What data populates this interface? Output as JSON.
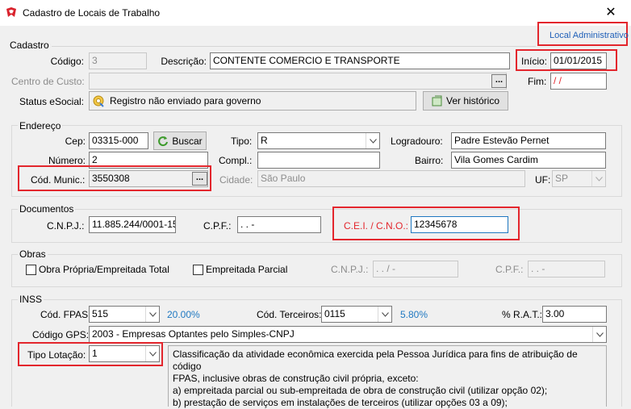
{
  "window": {
    "title": "Cadastro de Locais de Trabalho",
    "close_glyph": "✕"
  },
  "header": {
    "local_administrativo": "Local Administrativo"
  },
  "cadastro": {
    "section": "Cadastro",
    "codigo_label": "Código:",
    "codigo_value": "3",
    "descricao_label": "Descrição:",
    "descricao_value": "CONTENTE COMERCIO E TRANSPORTE",
    "inicio_label": "Início:",
    "inicio_value": "01/01/2015",
    "centro_label": "Centro de Custo:",
    "centro_value": "",
    "fim_label": "Fim:",
    "fim_value": " / /",
    "status_label": "Status eSocial:",
    "status_value": "Registro não enviado para governo",
    "historico_button": "Ver histórico",
    "ellipsis": "..."
  },
  "endereco": {
    "section": "Endereço",
    "cep_label": "Cep:",
    "cep_value": "03315-000",
    "buscar_button": "Buscar",
    "tipo_label": "Tipo:",
    "tipo_value": "R",
    "logradouro_label": "Logradouro:",
    "logradouro_value": "Padre Estevão Pernet",
    "numero_label": "Número:",
    "numero_value": "2",
    "compl_label": "Compl.:",
    "compl_value": "",
    "bairro_label": "Bairro:",
    "bairro_value": "Vila Gomes Cardim",
    "munic_label": "Cód. Munic.:",
    "munic_value": "3550308",
    "cidade_label": "Cidade:",
    "cidade_value": "São Paulo",
    "uf_label": "UF:",
    "uf_value": "SP",
    "ellipsis": "..."
  },
  "documentos": {
    "section": "Documentos",
    "cnpj_label": "C.N.P.J.:",
    "cnpj_value": "11.885.244/0001-15",
    "cpf_label": "C.P.F.:",
    "cpf_value": " .  .  -",
    "cei_label": "C.E.I. / C.N.O.:",
    "cei_value": "12345678"
  },
  "obras": {
    "section": "Obras",
    "propria_label": "Obra Própria/Empreitada Total",
    "parcial_label": "Empreitada Parcial",
    "cnpj_label": "C.N.P.J.:",
    "cnpj_value": " .  . /  -",
    "cpf_label": "C.P.F.:",
    "cpf_value": " .  .  -"
  },
  "inss": {
    "section": "INSS",
    "fpas_label": "Cód. FPAS:",
    "fpas_value": "515",
    "fpas_pct": "20.00%",
    "terceiros_label": "Cód. Terceiros:",
    "terceiros_value": "0115",
    "terceiros_pct": "5.80%",
    "rat_label": "% R.A.T.:",
    "rat_value": "3.00",
    "gps_label": "Código GPS:",
    "gps_value": "2003  - Empresas Optantes pelo Simples-CNPJ",
    "lotacao_label": "Tipo Lotação:",
    "lotacao_value": "1",
    "info_line1": "Classificação da atividade econômica exercida pela Pessoa Jurídica para fins de atribuição de código",
    "info_line2": "FPAS, inclusive obras de construção civil própria, exceto:",
    "info_line3": "a) empreitada parcial ou sub-empreitada de obra de construção civil (utilizar opção 02);",
    "info_line4": "b) prestação de serviços em instalações de terceiros (utilizar opções 03 a 09);"
  },
  "colors": {
    "highlight": "#e3262d",
    "link": "#1f5fb8",
    "percent": "#1f78c1"
  }
}
